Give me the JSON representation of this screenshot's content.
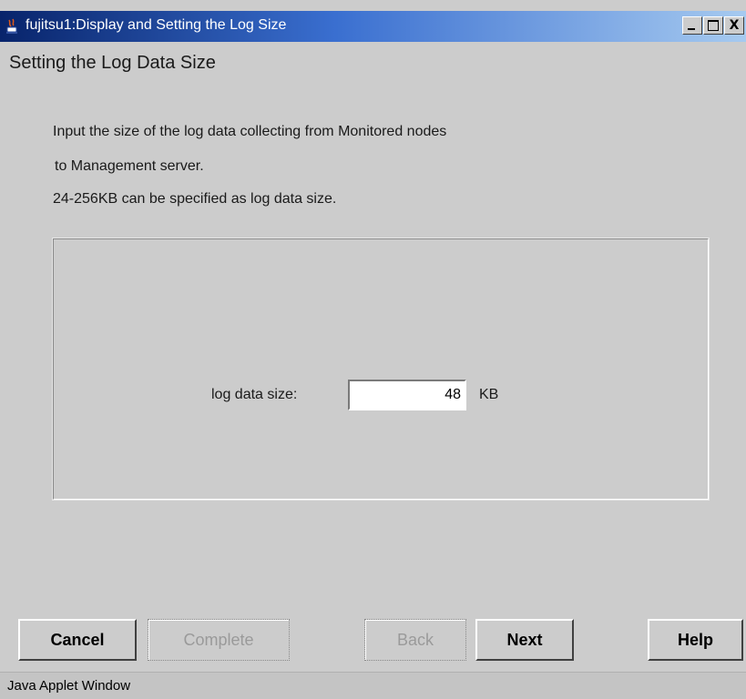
{
  "window": {
    "title": "fujitsu1:Display and Setting the Log Size",
    "icon": "java-cup-icon",
    "controls": {
      "minimize": "minimize-icon",
      "maximize": "maximize-icon",
      "close": "X"
    }
  },
  "heading": "Setting the Log Data Size",
  "description": [
    "Input the size of the log data collecting from Monitored nodes",
    "to Management server.",
    "24-256KB can be specified as log data size."
  ],
  "log_size": {
    "label": "log data size:",
    "value": "48",
    "unit": "KB"
  },
  "buttons": {
    "cancel": "Cancel",
    "complete": "Complete",
    "back": "Back",
    "next": "Next",
    "help": "Help"
  },
  "status": "Java Applet Window"
}
